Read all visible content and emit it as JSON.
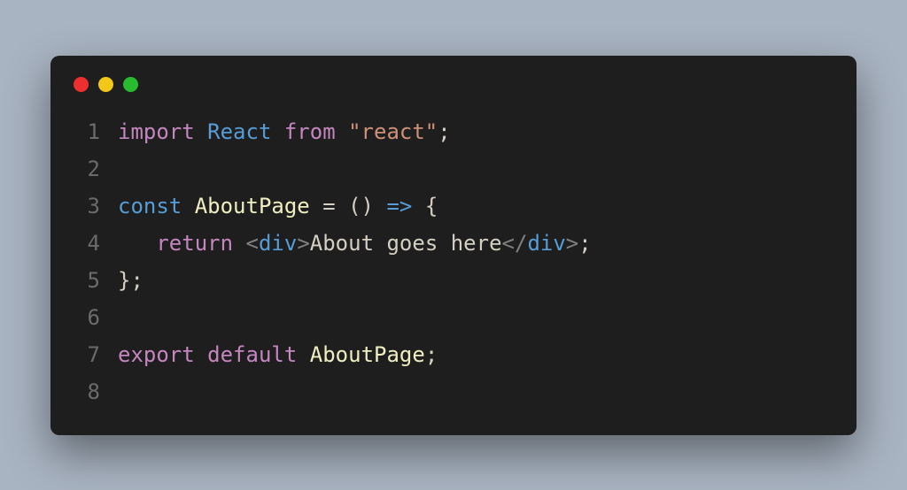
{
  "code": {
    "lines": [
      {
        "num": "1",
        "tokens": [
          {
            "cls": "tok-keyword",
            "t": "import"
          },
          {
            "cls": "tok-plain",
            "t": " "
          },
          {
            "cls": "tok-var",
            "t": "React"
          },
          {
            "cls": "tok-plain",
            "t": " "
          },
          {
            "cls": "tok-keyword",
            "t": "from"
          },
          {
            "cls": "tok-plain",
            "t": " "
          },
          {
            "cls": "tok-string",
            "t": "\"react\""
          },
          {
            "cls": "tok-punct",
            "t": ";"
          }
        ]
      },
      {
        "num": "2",
        "tokens": []
      },
      {
        "num": "3",
        "tokens": [
          {
            "cls": "tok-var",
            "t": "const"
          },
          {
            "cls": "tok-plain",
            "t": " "
          },
          {
            "cls": "tok-ident",
            "t": "AboutPage"
          },
          {
            "cls": "tok-plain",
            "t": " "
          },
          {
            "cls": "tok-punct",
            "t": "="
          },
          {
            "cls": "tok-plain",
            "t": " "
          },
          {
            "cls": "tok-punct",
            "t": "()"
          },
          {
            "cls": "tok-plain",
            "t": " "
          },
          {
            "cls": "tok-op",
            "t": "=>"
          },
          {
            "cls": "tok-plain",
            "t": " "
          },
          {
            "cls": "tok-punct",
            "t": "{"
          }
        ]
      },
      {
        "num": "4",
        "tokens": [
          {
            "cls": "tok-plain",
            "t": "   "
          },
          {
            "cls": "tok-keyword",
            "t": "return"
          },
          {
            "cls": "tok-plain",
            "t": " "
          },
          {
            "cls": "tok-tagbr",
            "t": "<"
          },
          {
            "cls": "tok-tag",
            "t": "div"
          },
          {
            "cls": "tok-tagbr",
            "t": ">"
          },
          {
            "cls": "tok-text",
            "t": "About goes here"
          },
          {
            "cls": "tok-tagbr",
            "t": "</"
          },
          {
            "cls": "tok-tag",
            "t": "div"
          },
          {
            "cls": "tok-tagbr",
            "t": ">"
          },
          {
            "cls": "tok-punct",
            "t": ";"
          }
        ]
      },
      {
        "num": "5",
        "tokens": [
          {
            "cls": "tok-punct",
            "t": "};"
          }
        ]
      },
      {
        "num": "6",
        "tokens": []
      },
      {
        "num": "7",
        "tokens": [
          {
            "cls": "tok-keyword",
            "t": "export"
          },
          {
            "cls": "tok-plain",
            "t": " "
          },
          {
            "cls": "tok-keyword",
            "t": "default"
          },
          {
            "cls": "tok-plain",
            "t": " "
          },
          {
            "cls": "tok-ident",
            "t": "AboutPage"
          },
          {
            "cls": "tok-punct",
            "t": ";"
          }
        ]
      },
      {
        "num": "8",
        "tokens": []
      }
    ]
  }
}
